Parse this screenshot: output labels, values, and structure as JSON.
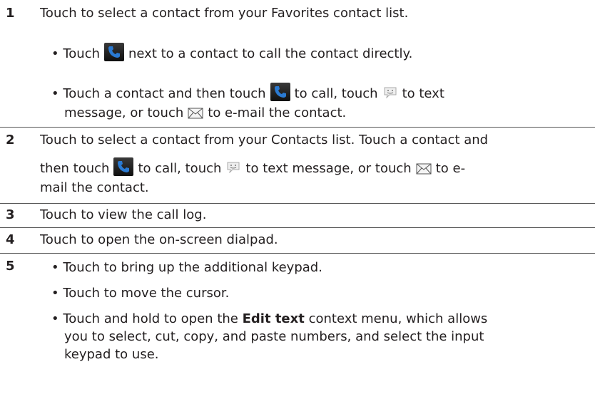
{
  "rows": [
    {
      "number": "1",
      "main": "Touch to select a contact from your Favorites contact list.",
      "bullet1_pre": "• Touch",
      "bullet1_post": "next to a contact to call the contact directly.",
      "bullet2_pre": "• Touch a contact and then touch",
      "bullet2_mid1": "to call, touch",
      "bullet2_mid2": "to text",
      "bullet2_line2_pre": "message, or touch",
      "bullet2_line2_post": "to e-mail the contact."
    },
    {
      "number": "2",
      "line1": "Touch to select a contact from your Contacts list. Touch a contact and",
      "line2_pre": "then touch",
      "line2_mid1": "to call, touch",
      "line2_mid2": "to text message, or touch",
      "line2_post": "to e-",
      "line3": "mail the contact."
    },
    {
      "number": "3",
      "text": "Touch to view the call log."
    },
    {
      "number": "4",
      "text": "Touch to open the on-screen dialpad."
    },
    {
      "number": "5",
      "bullet1": "• Touch to bring up the additional keypad.",
      "bullet2": "• Touch to move the cursor.",
      "bullet3_pre": "• Touch and hold to open the",
      "bullet3_bold": "Edit text",
      "bullet3_post": "context menu, which allows",
      "bullet3_line2": "you to select, cut, copy, and paste numbers, and select the input",
      "bullet3_line3": "keypad to use."
    }
  ],
  "icons": {
    "call": "phone-icon",
    "text": "sms-bubble-icon",
    "email": "envelope-icon"
  },
  "colors": {
    "text": "#231f20",
    "phone_icon_bg": "#1a1a1a",
    "phone_icon_fg": "#2a7ad2",
    "rule": "#555555"
  }
}
